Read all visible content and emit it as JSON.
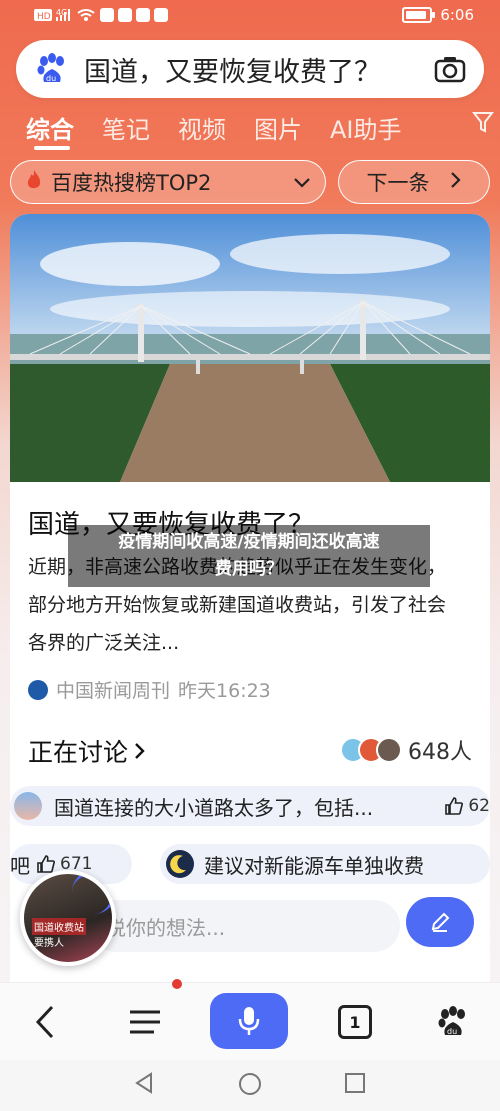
{
  "status_bar": {
    "left_icons": [
      "HD",
      "4G",
      "signal",
      "wifi",
      "app-icons"
    ],
    "time": "6:06"
  },
  "search": {
    "query": "国道，又要恢复收费了？",
    "logo_icon": "baidu-paw-logo",
    "camera_icon": "camera-icon"
  },
  "tabs": {
    "items": [
      "综合",
      "笔记",
      "视频",
      "图片",
      "AI助手"
    ],
    "active_index": 0,
    "filter_icon": "filter-icon"
  },
  "pills": {
    "hot_label": "百度热搜榜TOP2",
    "next_label": "下一条"
  },
  "article": {
    "title": "国道，又要恢复收费了？",
    "body": "近期，非高速公路收费的趋势似乎正在发生变化，部分地方开始恢复或新建国道收费站，引发了社会各界的广泛关注...",
    "source": "中国新闻周刊",
    "time": "昨天16:23"
  },
  "overlay": {
    "line1": "疫情期间收高速/疫情期间还收高速",
    "line2": "费用吗？"
  },
  "discussion": {
    "heading": "正在讨论",
    "count": "648人",
    "comments": [
      {
        "text": "国道连接的大小道路太多了，包括...",
        "likes": "62"
      },
      {
        "text": "吧",
        "likes": "671"
      },
      {
        "text": "建议对新能源车单独收费",
        "likes": ""
      }
    ],
    "input_placeholder": "说你的想法..."
  },
  "video_bubble": {
    "caption1": "国道收费站",
    "caption2": "要携人"
  },
  "bottom_nav": {
    "tab_count": "1"
  },
  "colors": {
    "accent": "#4e6bf5",
    "brand_gradient_top": "#ef6a4e",
    "notification_dot": "#e53935"
  }
}
